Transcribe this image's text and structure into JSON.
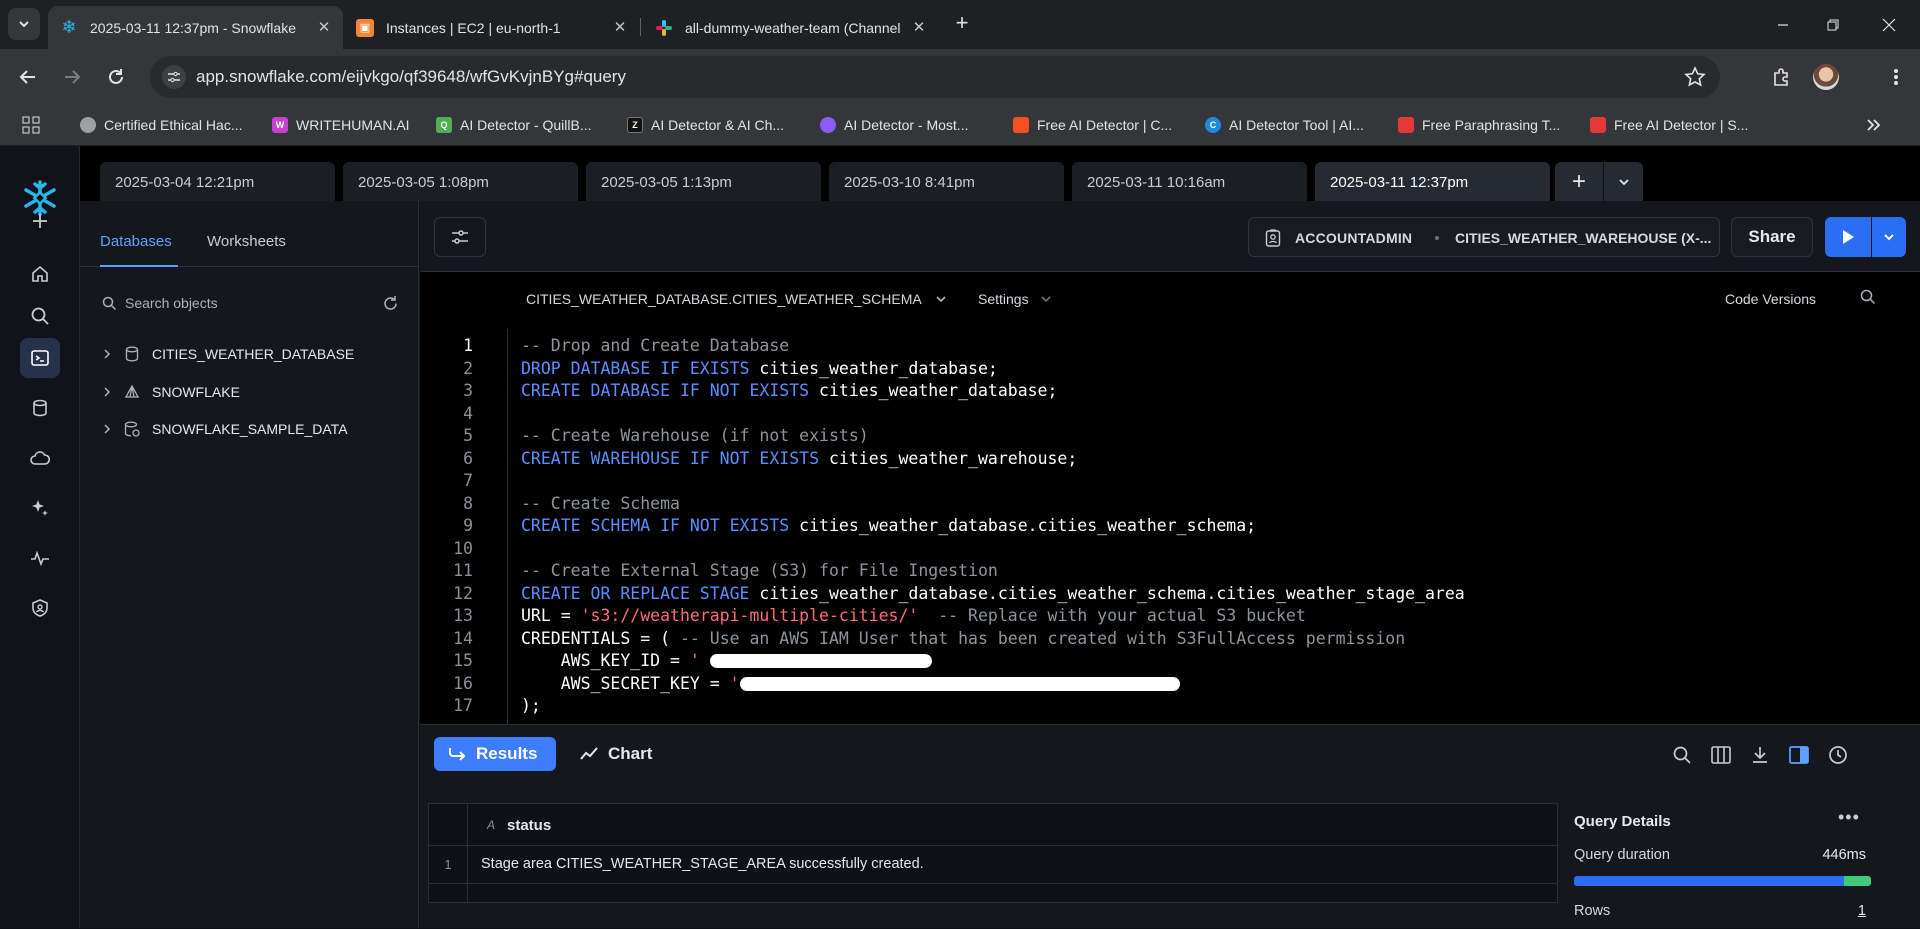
{
  "browser": {
    "tabs": [
      {
        "title": "2025-03-11 12:37pm - Snowflake",
        "favicon": "snowflake-icon"
      },
      {
        "title": "Instances | EC2 | eu-north-1",
        "favicon": "aws-icon"
      },
      {
        "title": "all-dummy-weather-team (Channel)",
        "favicon": "slack-icon"
      }
    ],
    "url": "app.snowflake.com/eijvkgo/qf39648/wfGvKvjnBYg#query",
    "bookmarks": [
      {
        "label": "Certified Ethical Hac...",
        "icon": "globe-icon"
      },
      {
        "label": "WRITEHUMAN.AI",
        "icon": "writehuman-icon"
      },
      {
        "label": "AI Detector - QuillB...",
        "icon": "quillbot-icon"
      },
      {
        "label": "AI Detector & AI Ch...",
        "icon": "zerogpt-icon"
      },
      {
        "label": "AI Detector - Most...",
        "icon": "brain-icon"
      },
      {
        "label": "Free AI Detector | C...",
        "icon": "copyleaks-icon"
      },
      {
        "label": "AI Detector Tool | AI...",
        "icon": "c-icon"
      },
      {
        "label": "Free Paraphrasing T...",
        "icon": "scribbr-icon"
      },
      {
        "label": "Free AI Detector | S...",
        "icon": "scribbr-icon"
      }
    ]
  },
  "worksheets": {
    "tabs": [
      "2025-03-04 12:21pm",
      "2025-03-05 1:08pm",
      "2025-03-05 1:13pm",
      "2025-03-10 8:41pm",
      "2025-03-11 10:16am",
      "2025-03-11 12:37pm"
    ],
    "active_index": 5
  },
  "object_panel": {
    "tabs": [
      "Databases",
      "Worksheets"
    ],
    "search_placeholder": "Search objects",
    "items": [
      "CITIES_WEATHER_DATABASE",
      "SNOWFLAKE",
      "SNOWFLAKE_SAMPLE_DATA"
    ]
  },
  "header": {
    "role": "ACCOUNTADMIN",
    "warehouse": "CITIES_WEATHER_WAREHOUSE (X-...",
    "share_label": "Share"
  },
  "editor": {
    "context": "CITIES_WEATHER_DATABASE.CITIES_WEATHER_SCHEMA",
    "settings_label": "Settings",
    "code_versions_label": "Code Versions",
    "current_line": 1,
    "lines": [
      {
        "n": 1,
        "parts": [
          [
            "cm",
            "-- Drop and Create Database"
          ]
        ]
      },
      {
        "n": 2,
        "parts": [
          [
            "kw",
            "DROP DATABASE IF EXISTS "
          ],
          [
            "id",
            "cities_weather_database;"
          ]
        ]
      },
      {
        "n": 3,
        "parts": [
          [
            "kw",
            "CREATE DATABASE IF NOT EXISTS "
          ],
          [
            "id",
            "cities_weather_database;"
          ]
        ]
      },
      {
        "n": 4,
        "parts": []
      },
      {
        "n": 5,
        "parts": [
          [
            "cm",
            "-- Create Warehouse (if not exists)"
          ]
        ]
      },
      {
        "n": 6,
        "parts": [
          [
            "kw",
            "CREATE WAREHOUSE IF NOT EXISTS "
          ],
          [
            "id",
            "cities_weather_warehouse;"
          ]
        ]
      },
      {
        "n": 7,
        "parts": []
      },
      {
        "n": 8,
        "parts": [
          [
            "cm",
            "-- Create Schema"
          ]
        ]
      },
      {
        "n": 9,
        "parts": [
          [
            "kw",
            "CREATE SCHEMA IF NOT EXISTS "
          ],
          [
            "id",
            "cities_weather_database.cities_weather_schema;"
          ]
        ]
      },
      {
        "n": 10,
        "parts": []
      },
      {
        "n": 11,
        "parts": [
          [
            "cm",
            "-- Create External Stage (S3) for File Ingestion"
          ]
        ]
      },
      {
        "n": 12,
        "parts": [
          [
            "kw",
            "CREATE OR REPLACE STAGE "
          ],
          [
            "id",
            "cities_weather_database.cities_weather_schema.cities_weather_stage_area"
          ]
        ]
      },
      {
        "n": 13,
        "parts": [
          [
            "id",
            "URL = "
          ],
          [
            "st",
            "'s3://weatherapi-multiple-cities/'"
          ],
          [
            "cm",
            "  -- Replace with your actual S3 bucket"
          ]
        ]
      },
      {
        "n": 14,
        "parts": [
          [
            "id",
            "CREDENTIALS = ( "
          ],
          [
            "cm",
            "-- Use an AWS IAM User that has been created with S3FullAccess permission"
          ]
        ]
      },
      {
        "n": 15,
        "parts": [
          [
            "id",
            "    AWS_KEY_ID = "
          ],
          [
            "st",
            "'"
          ]
        ]
      },
      {
        "n": 16,
        "parts": [
          [
            "id",
            "    AWS_SECRET_KEY = "
          ],
          [
            "st",
            "'"
          ]
        ]
      },
      {
        "n": 17,
        "parts": [
          [
            "id",
            ");"
          ]
        ]
      }
    ]
  },
  "results": {
    "results_label": "Results",
    "chart_label": "Chart",
    "column_type": "A",
    "column": "status",
    "rows": [
      {
        "n": "1",
        "status": "Stage area CITIES_WEATHER_STAGE_AREA successfully created."
      }
    ],
    "query_details": {
      "title": "Query Details",
      "duration_label": "Query duration",
      "duration_value": "446ms",
      "rows_label": "Rows",
      "rows_value": "1",
      "duration_bar": {
        "compile_fraction": 0.91,
        "execute_fraction": 0.09
      }
    }
  },
  "colors": {
    "accent": "#2a6ef3",
    "keyword": "#5d8dff",
    "comment": "#8e949c",
    "string": "#ff6b78"
  }
}
